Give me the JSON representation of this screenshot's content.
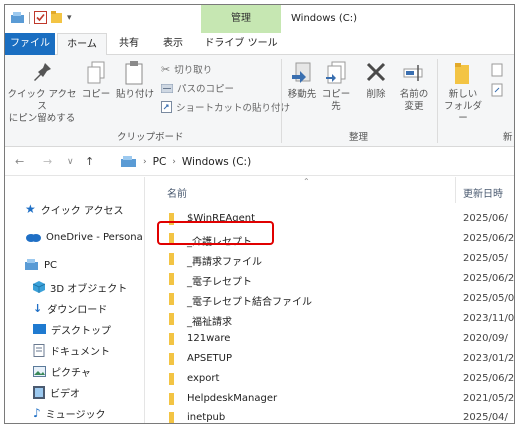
{
  "titlebar": {
    "context_tab": "管理",
    "window_title": "Windows (C:)"
  },
  "ribbon_tabs": {
    "file": "ファイル",
    "home": "ホーム",
    "share": "共有",
    "view": "表示",
    "drive_tools": "ドライブ ツール"
  },
  "ribbon": {
    "pin_label_1": "クイック アクセス",
    "pin_label_2": "にピン留めする",
    "copy": "コピー",
    "paste": "貼り付け",
    "cut": "切り取り",
    "copy_path": "パスのコピー",
    "paste_shortcut": "ショートカットの貼り付け",
    "clipboard_group": "クリップボード",
    "move_to": "移動先",
    "copy_to": "コピー先",
    "delete": "削除",
    "rename_1": "名前の",
    "rename_2": "変更",
    "organize_group": "整理",
    "new_folder_1": "新しい",
    "new_folder_2": "フォルダー",
    "new_group_partial": "新"
  },
  "address": {
    "pc": "PC",
    "drive": "Windows (C:)"
  },
  "navpane": {
    "items": [
      {
        "label": "クイック アクセス",
        "icon": "star-icon"
      },
      {
        "label": "OneDrive - Persona",
        "icon": "cloud-icon"
      },
      {
        "label": "PC",
        "icon": "pc-icon"
      },
      {
        "label": "3D オブジェクト",
        "icon": "cube-icon"
      },
      {
        "label": "ダウンロード",
        "icon": "download-icon"
      },
      {
        "label": "デスクトップ",
        "icon": "desktop-icon"
      },
      {
        "label": "ドキュメント",
        "icon": "document-icon"
      },
      {
        "label": "ピクチャ",
        "icon": "picture-icon"
      },
      {
        "label": "ビデオ",
        "icon": "video-icon"
      },
      {
        "label": "ミュージック",
        "icon": "music-icon"
      }
    ]
  },
  "filelist": {
    "col_name": "名前",
    "col_date": "更新日時",
    "rows": [
      {
        "name": "$WinREAgent",
        "date": "2025/06/"
      },
      {
        "name": "_介護レセプト",
        "date": "2025/06/2"
      },
      {
        "name": "_再請求ファイル",
        "date": "2025/05/"
      },
      {
        "name": "_電子レセプト",
        "date": "2025/06/2"
      },
      {
        "name": "_電子レセプト結合ファイル",
        "date": "2025/05/0"
      },
      {
        "name": "_福祉請求",
        "date": "2023/11/0"
      },
      {
        "name": "121ware",
        "date": "2020/09/"
      },
      {
        "name": "APSETUP",
        "date": "2023/01/2"
      },
      {
        "name": "export",
        "date": "2025/06/2"
      },
      {
        "name": "HelpdeskManager",
        "date": "2021/05/2"
      },
      {
        "name": "inetpub",
        "date": "2025/04/"
      }
    ]
  },
  "colors": {
    "file_tab": "#1a6ec1",
    "context_tab": "#c6e7b2",
    "highlight": "#e00000",
    "folder": "#f3c444"
  }
}
